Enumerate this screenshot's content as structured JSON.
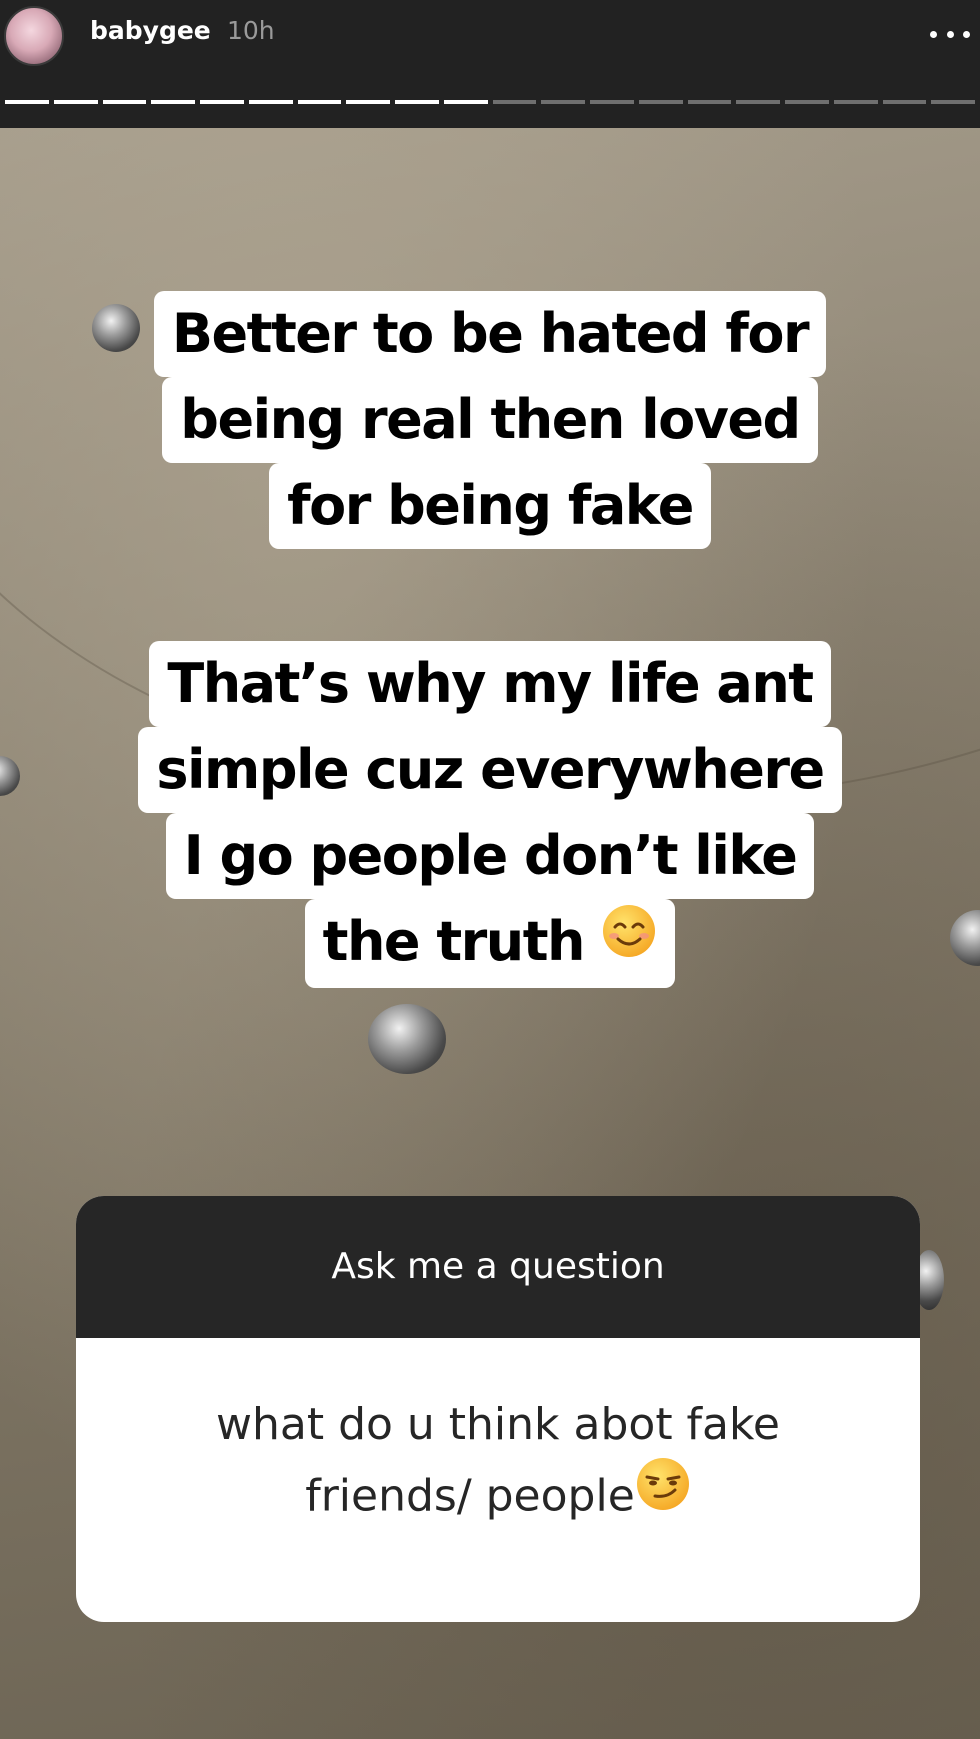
{
  "header": {
    "username": "babygee",
    "timestamp": "10h",
    "progress": {
      "total_segments": 20,
      "viewed_segments": 10
    }
  },
  "story": {
    "caption_1": {
      "lines": [
        "Better to be hated for",
        "being real then loved",
        "for being fake"
      ]
    },
    "caption_2": {
      "lines": [
        "That’s why my life ant",
        "simple cuz everywhere",
        "I go people don’t like",
        "the truth"
      ],
      "emoji_icon": "smiling-face-with-smiling-eyes-icon"
    },
    "question_sticker": {
      "title": "Ask me a question",
      "question_lines": [
        "what do u think abot fake",
        "friends/ people"
      ],
      "emoji_icon": "smirking-face-icon"
    }
  },
  "colors": {
    "topbar_background": "#222222",
    "sticker_header": "#262626",
    "caption_background": "#ffffff",
    "caption_text": "#000000"
  }
}
